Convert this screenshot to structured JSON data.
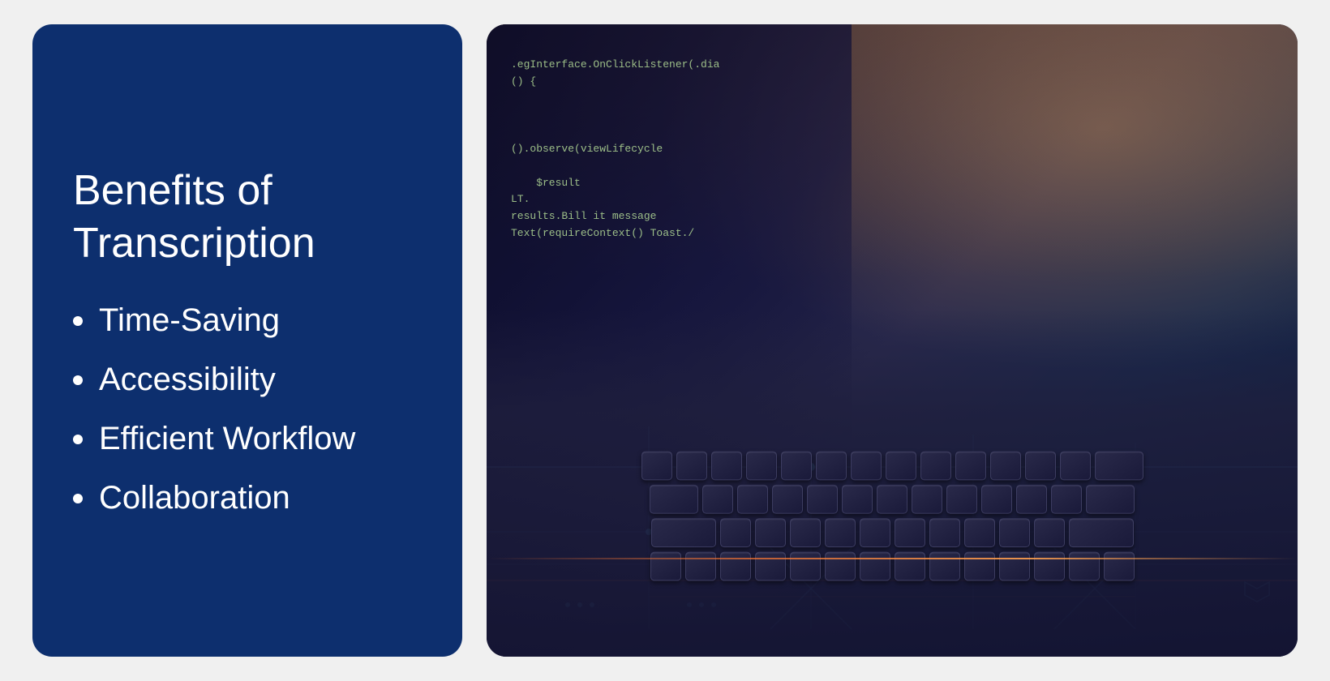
{
  "left": {
    "title_line1": "Benefits of",
    "title_line2": "Transcription",
    "bullet_items": [
      {
        "id": "time-saving",
        "label": "Time-Saving"
      },
      {
        "id": "accessibility",
        "label": "Accessibility"
      },
      {
        "id": "efficient-workflow",
        "label": "Efficient Workflow"
      },
      {
        "id": "collaboration",
        "label": "Collaboration"
      }
    ],
    "bg_color": "#0d2f6e"
  },
  "right": {
    "code_snippet": ".egInterface.OnClickListener(.dia\n() {\n\n\n\n().observe(viewLifecycle\n\n    $result\nLT.\nresults.Bill it message\nText(requireContext() Toast./"
  }
}
